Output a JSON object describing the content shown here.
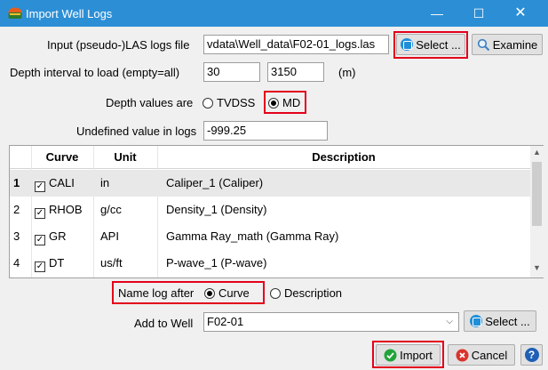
{
  "window": {
    "title": "Import Well Logs",
    "minimize_glyph": "—",
    "maximize_glyph": "☐",
    "close_glyph": "✕"
  },
  "input_file": {
    "label": "Input (pseudo-)LAS logs file",
    "value": "vdata\\Well_data\\F02-01_logs.las",
    "select_label": "Select ...",
    "examine_label": "Examine"
  },
  "depth_interval": {
    "label": "Depth interval to load (empty=all)",
    "start": "30",
    "end": "3150",
    "unit": "(m)"
  },
  "depth_values": {
    "label": "Depth values are",
    "option_tvdss": "TVDSS",
    "option_md": "MD",
    "selected": "MD"
  },
  "undefined_value": {
    "label": "Undefined value in logs",
    "value": "-999.25"
  },
  "table": {
    "headers": [
      "Curve",
      "Unit",
      "Description"
    ],
    "rows": [
      {
        "num": "1",
        "curve": "CALI",
        "unit": "in",
        "description": "Caliper_1 (Caliper)",
        "checked": true
      },
      {
        "num": "2",
        "curve": "RHOB",
        "unit": "g/cc",
        "description": "Density_1 (Density)",
        "checked": true
      },
      {
        "num": "3",
        "curve": "GR",
        "unit": "API",
        "description": "Gamma Ray_math (Gamma Ray)",
        "checked": true
      },
      {
        "num": "4",
        "curve": "DT",
        "unit": "us/ft",
        "description": "P-wave_1 (P-wave)",
        "checked": true
      }
    ]
  },
  "name_log": {
    "label": "Name log after",
    "option_curve": "Curve",
    "option_description": "Description",
    "selected": "Curve"
  },
  "add_to_well": {
    "label": "Add to Well",
    "value": "F02-01",
    "select_label": "Select ..."
  },
  "buttons": {
    "import": "Import",
    "cancel": "Cancel",
    "help": "?"
  },
  "colors": {
    "titlebar": "#2c8fd6",
    "highlight": "#e3001b",
    "import_icon": "#22a33a",
    "cancel_icon": "#d9342b",
    "help_icon": "#1f5fb5"
  }
}
